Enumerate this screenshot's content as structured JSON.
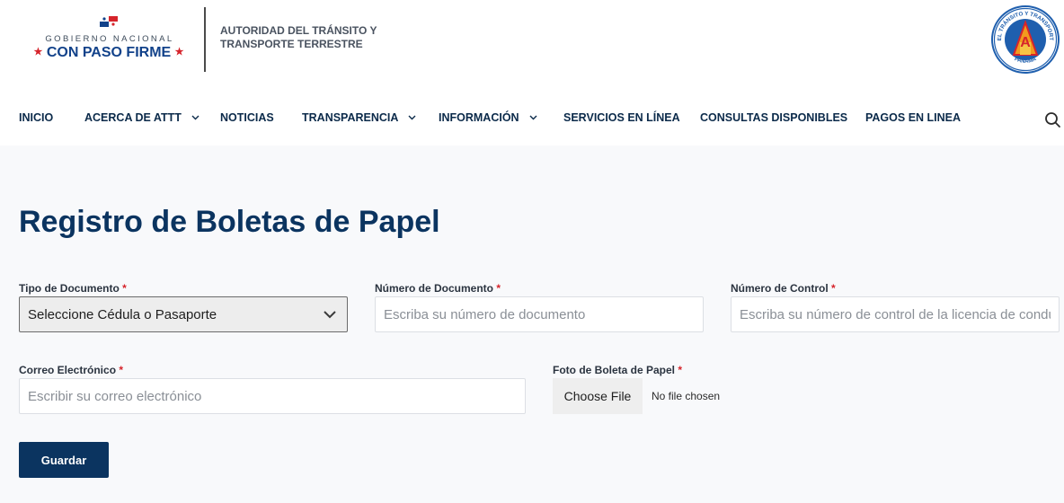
{
  "header": {
    "gobierno_top": "GOBIERNO NACIONAL",
    "gobierno_slogan": "CON PASO FIRME",
    "agency_line1": "AUTORIDAD DEL TRÁNSITO Y",
    "agency_line2": "TRANSPORTE TERRESTRE",
    "seal_top_text": "AUTORIDAD DEL TRÁNSITO Y TRANSPORTE TERRESTRE",
    "seal_bottom_text": "PANAMA",
    "seal_letter": "A"
  },
  "nav": {
    "items": [
      {
        "label": "INICIO",
        "has_dropdown": false
      },
      {
        "label": "ACERCA DE ATTT",
        "has_dropdown": true
      },
      {
        "label": "NOTICIAS",
        "has_dropdown": false
      },
      {
        "label": "TRANSPARENCIA",
        "has_dropdown": true
      },
      {
        "label": "INFORMACIÓN",
        "has_dropdown": true
      },
      {
        "label": "SERVICIOS EN LÍNEA",
        "has_dropdown": false
      },
      {
        "label": "CONSULTAS DISPONIBLES",
        "has_dropdown": false
      },
      {
        "label": "PAGOS EN LINEA",
        "has_dropdown": false
      }
    ],
    "search_icon": "search-icon"
  },
  "form": {
    "title": "Registro de Boletas de Papel",
    "required_mark": "*",
    "doc_type": {
      "label": "Tipo de Documento",
      "selected": "Seleccione Cédula o Pasaporte"
    },
    "doc_number": {
      "label": "Número de Documento",
      "placeholder": "Escriba su número de documento"
    },
    "control_number": {
      "label": "Número de Control",
      "placeholder": "Escriba su número de control de la licencia de conducir"
    },
    "email": {
      "label": "Correo Electrónico",
      "placeholder": "Escribir su correo electrónico"
    },
    "photo": {
      "label": "Foto de Boleta de Papel",
      "button": "Choose File",
      "status": "No file chosen"
    },
    "save_label": "Guardar"
  },
  "colors": {
    "brand_navy": "#0b3460",
    "nav_text": "#0b2a4a",
    "required_red": "#d6242b",
    "page_bg": "#f8f9fb"
  }
}
